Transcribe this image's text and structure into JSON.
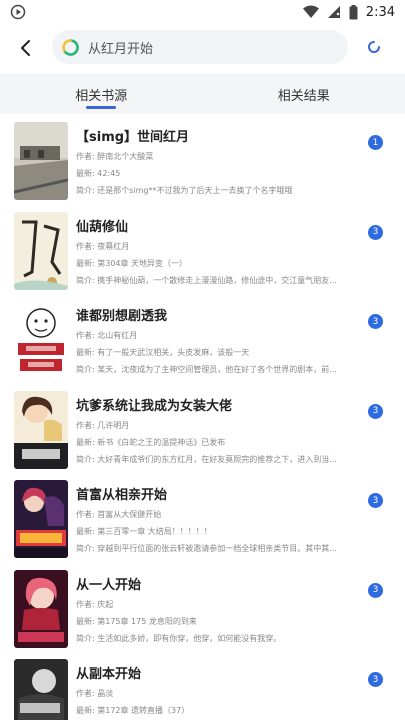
{
  "status_bar": {
    "time": "2:34",
    "icons": [
      "app-indicator-icon",
      "wifi-icon",
      "signal-icon",
      "battery-icon"
    ]
  },
  "header": {
    "back_icon": "back-arrow-icon",
    "search_text": "从红月开始",
    "search_icon": "search-ring-icon",
    "refresh_icon": "refresh-icon"
  },
  "tabs": [
    {
      "label": "相关书源",
      "active": true
    },
    {
      "label": "相关结果",
      "active": false
    }
  ],
  "books": [
    {
      "title": "【simg】世间红月",
      "author": "作者: 醉南北个大酸菜",
      "latest": "最新: 42:45",
      "intro": "简介: 还是那个simg**不过我为了后天上一去换了个名字哦哦",
      "badge": "1",
      "cover": "landscape"
    },
    {
      "title": "仙葫修仙",
      "author": "作者: 夜幕红月",
      "latest": "最新: 第304章 天地异变（一）",
      "intro": "简介: 携手神秘仙葫，一个散修走上漫漫仙路，修仙途中，交江童气朋友...",
      "badge": "3",
      "cover": "calligraphy"
    },
    {
      "title": "谁都别想剧透我",
      "author": "作者: 北山有红月",
      "latest": "最新: 有了一般天武汉相关，头皮发麻，该般一天",
      "intro": "简介: 某天，沈夜成为了主神空间管理员，他在好了各个世界的剧本，前...",
      "badge": "3",
      "cover": "meme"
    },
    {
      "title": "坑爹系统让我成为女装大佬",
      "author": "作者: 几许明月",
      "latest": "最新: 新书《白蛇之王的温提神话》已发布",
      "intro": "简介: 大好青年成爷们的东方红月，在好友莫照完的推荐之下，进入到当...",
      "badge": "3",
      "cover": "anime"
    },
    {
      "title": "首富从相亲开始",
      "author": "作者: 首富从大保健开始",
      "latest": "最新: 第三百零一章 大结局！！！！！",
      "intro": "简介: 穿越到平行位面的张云轩被邀请参加一档全球相亲类节目。其中其...",
      "badge": "3",
      "cover": "poster"
    },
    {
      "title": "从一人开始",
      "author": "作者: 庆起",
      "latest": "最新: 第175章 175 龙息阳的到来",
      "intro": "简介: 生活如此多娇，即有你穿，他穿，如何能没有我穿。",
      "badge": "3",
      "cover": "anime-red"
    },
    {
      "title": "从副本开始",
      "author": "作者: 晶淡",
      "latest": "最新: 第172章 遗转直播（37）",
      "intro": "",
      "badge": "3",
      "cover": "dark"
    }
  ]
}
